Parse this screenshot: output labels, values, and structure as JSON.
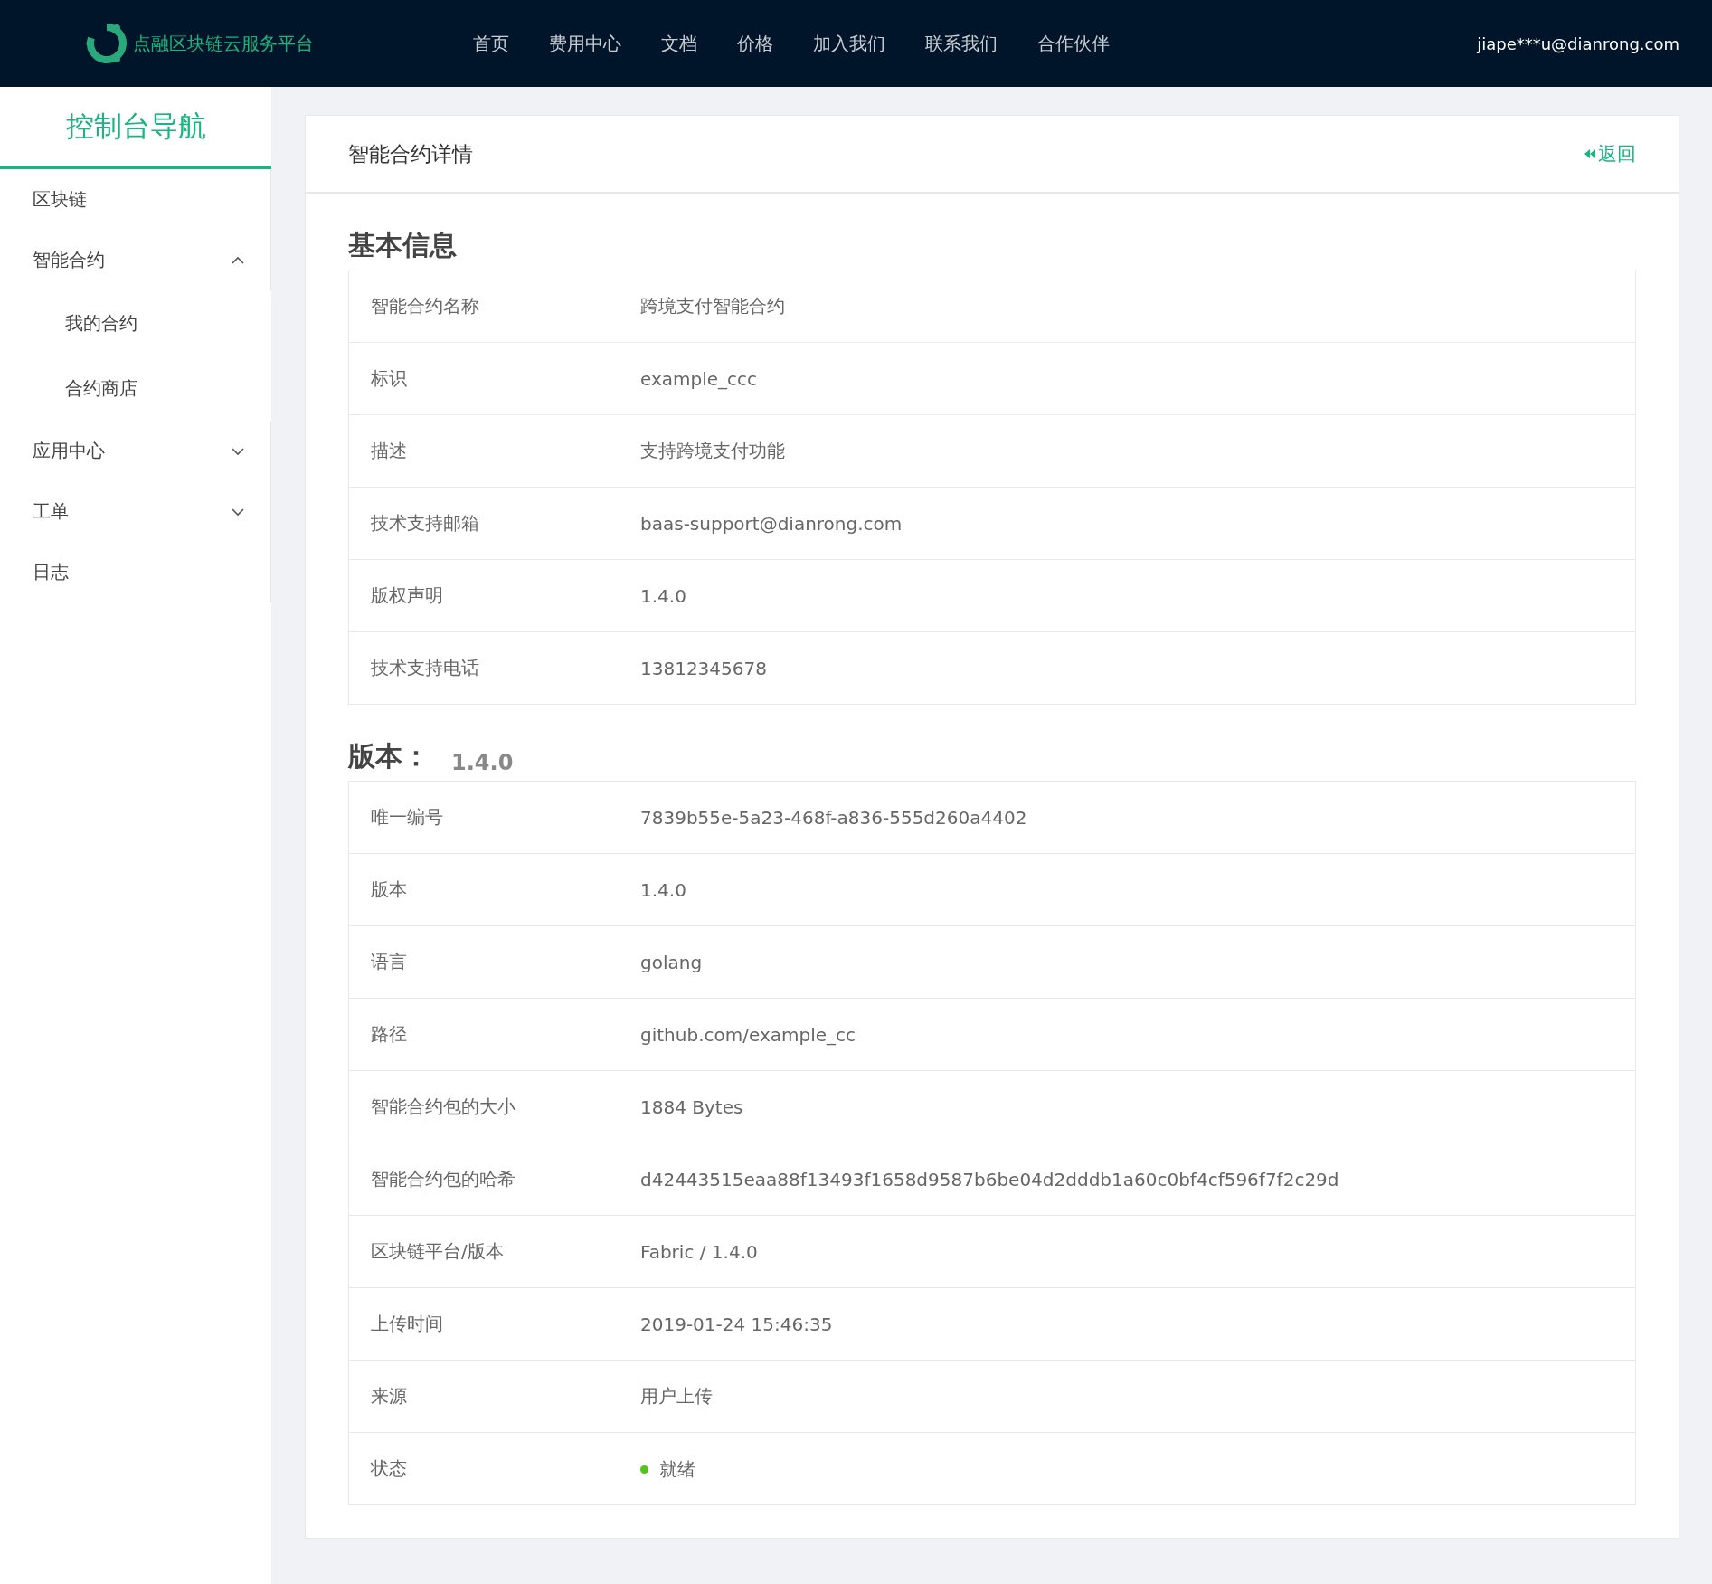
{
  "header": {
    "logo_text": "点融区块链云服务平台",
    "nav": [
      "首页",
      "费用中心",
      "文档",
      "价格",
      "加入我们",
      "联系我们",
      "合作伙伴"
    ],
    "user": "jiape***u@dianrong.com"
  },
  "sidebar": {
    "title": "控制台导航",
    "items": [
      {
        "label": "区块链"
      },
      {
        "label": "智能合约",
        "expanded": true,
        "children": [
          {
            "label": "我的合约"
          },
          {
            "label": "合约商店"
          }
        ]
      },
      {
        "label": "应用中心",
        "expanded": false
      },
      {
        "label": "工单",
        "expanded": false
      },
      {
        "label": "日志"
      }
    ]
  },
  "panel": {
    "title": "智能合约详情",
    "back_link": "返回",
    "sections": [
      {
        "title": "基本信息",
        "rows": [
          {
            "kind": "text",
            "label": "智能合约名称",
            "value": "跨境支付智能合约"
          },
          {
            "kind": "text",
            "label": "标识",
            "value": "example_ccc"
          },
          {
            "kind": "text",
            "label": "描述",
            "value": "支持跨境支付功能"
          },
          {
            "kind": "text",
            "label": "技术支持邮箱",
            "value": "baas-support@dianrong.com"
          },
          {
            "kind": "text",
            "label": "版权声明",
            "value": "1.4.0"
          },
          {
            "kind": "text",
            "label": "技术支持电话",
            "value": "13812345678"
          }
        ]
      },
      {
        "title": "版本：",
        "subtitle": "1.4.0",
        "rows": [
          {
            "kind": "text",
            "label": "唯一编号",
            "value": "7839b55e-5a23-468f-a836-555d260a4402"
          },
          {
            "kind": "text",
            "label": "版本",
            "value": "1.4.0"
          },
          {
            "kind": "text",
            "label": "语言",
            "value": "golang"
          },
          {
            "kind": "text",
            "label": "路径",
            "value": "github.com/example_cc"
          },
          {
            "kind": "text",
            "label": "智能合约包的大小",
            "value": "1884 Bytes"
          },
          {
            "kind": "text",
            "label": "智能合约包的哈希",
            "value": "d42443515eaa88f13493f1658d9587b6be04d2dddb1a60c0bf4cf596f7f2c29d"
          },
          {
            "kind": "text",
            "label": "区块链平台/版本",
            "value": "Fabric / 1.4.0"
          },
          {
            "kind": "text",
            "label": "上传时间",
            "value": "2019-01-24 15:46:35"
          },
          {
            "kind": "text",
            "label": "来源",
            "value": "用户上传"
          },
          {
            "kind": "status",
            "label": "状态",
            "value": "就绪"
          }
        ]
      }
    ]
  }
}
